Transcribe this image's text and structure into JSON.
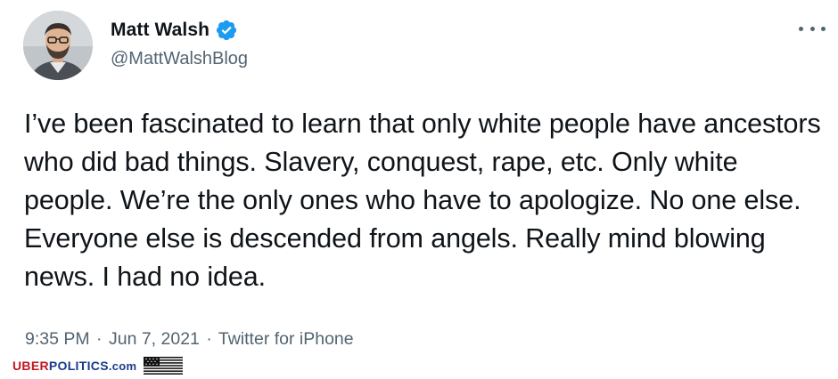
{
  "author": {
    "display_name": "Matt Walsh",
    "handle": "@MattWalshBlog",
    "verified": true,
    "verified_color": "#1d9bf0"
  },
  "tweet": {
    "text": "I’ve been fascinated to learn that only white people have ancestors who did bad things. Slavery, conquest, rape, etc. Only white people. We’re the only ones who have to apologize. No one else. Everyone else is descended from angels. Really mind blowing news. I had no idea."
  },
  "meta": {
    "time": "9:35 PM",
    "separator": "·",
    "date": "Jun 7, 2021",
    "source": "Twitter for iPhone"
  },
  "menu": {
    "icon": "more-horizontal-icon"
  },
  "watermark": {
    "part1": "UBER",
    "part2": "POLITICS",
    "part3": ".com",
    "icon": "us-flag-icon"
  },
  "colors": {
    "text_primary": "#0f1419",
    "text_secondary": "#536471",
    "watermark_red": "#c0181f",
    "watermark_blue": "#1b3a8c"
  }
}
